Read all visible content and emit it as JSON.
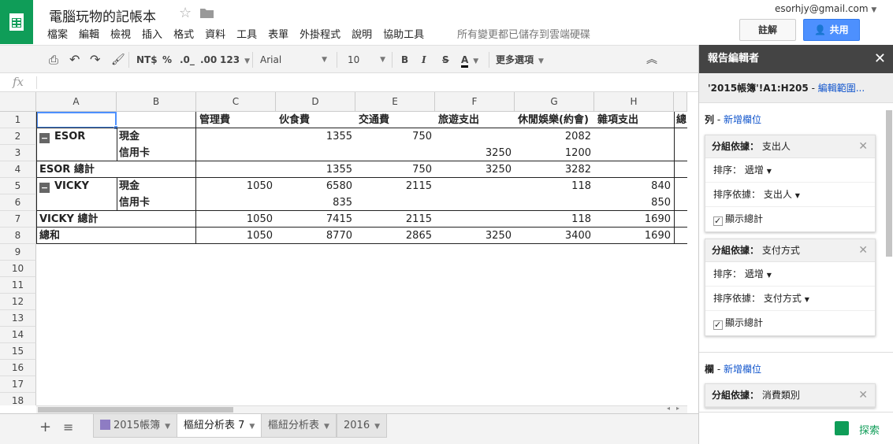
{
  "doc": {
    "title": "電腦玩物的記帳本",
    "saved_status": "所有變更都已儲存到雲端硬碟"
  },
  "menu": [
    "檔案",
    "編輯",
    "檢視",
    "插入",
    "格式",
    "資料",
    "工具",
    "表單",
    "外掛程式",
    "說明",
    "協助工具"
  ],
  "account": {
    "email": "esorhjy@gmail.com",
    "comment_label": "註解",
    "share_label": "共用"
  },
  "toolbar": {
    "currency": "NT$",
    "percent": "%",
    "dec_less": ".0_",
    "dec_more": ".00",
    "format_more": "123",
    "font": "Arial",
    "size": "10",
    "bold": "B",
    "italic": "I",
    "strike": "S",
    "text_color": "A",
    "more": "更多選項"
  },
  "formula": {
    "fx": "fx"
  },
  "grid": {
    "columns": [
      "A",
      "B",
      "C",
      "D",
      "E",
      "F",
      "G",
      "H"
    ],
    "rows": [
      "1",
      "2",
      "3",
      "4",
      "5",
      "6",
      "7",
      "8",
      "9",
      "10",
      "11",
      "12",
      "13",
      "14",
      "15",
      "16",
      "17",
      "18"
    ],
    "headers": {
      "c": "管理費",
      "d": "伙食費",
      "e": "交通費",
      "f": "旅遊支出",
      "g": "休閒娛樂(約會)",
      "h": "雜項支出",
      "i": "總"
    },
    "r2": {
      "a": "ESOR",
      "b": "現金",
      "d": "1355",
      "e": "750",
      "g": "2082"
    },
    "r3": {
      "b": "信用卡",
      "f": "3250",
      "g": "1200"
    },
    "r4": {
      "a": "ESOR 總計",
      "d": "1355",
      "e": "750",
      "f": "3250",
      "g": "3282"
    },
    "r5": {
      "a": "VICKY",
      "b": "現金",
      "c": "1050",
      "d": "6580",
      "e": "2115",
      "g": "118",
      "h": "840"
    },
    "r6": {
      "b": "信用卡",
      "d": "835",
      "h": "850"
    },
    "r7": {
      "a": "VICKY 總計",
      "c": "1050",
      "d": "7415",
      "e": "2115",
      "g": "118",
      "h": "1690"
    },
    "r8": {
      "a": "總和",
      "c": "1050",
      "d": "8770",
      "e": "2865",
      "f": "3250",
      "g": "3400",
      "h": "1690"
    }
  },
  "sheets": [
    "2015帳簿",
    "樞紐分析表 7",
    "樞紐分析表",
    "2016"
  ],
  "panel": {
    "title": "報告編輯者",
    "range": "'2015帳簿'!A1:H205",
    "range_sep": " - ",
    "edit_range": "編輯範圍...",
    "rows_label": "列",
    "cols_label": "欄",
    "add_field": "新增欄位",
    "sep": " - ",
    "group_by": "分組依據：",
    "order_label": "排序：",
    "order_value": "遞增",
    "sort_by_label": "排序依據：",
    "show_totals": "顯示總計",
    "card1_field": "支出人",
    "card2_field": "支付方式",
    "card3_field": "消費類別"
  },
  "explore": {
    "label": "探索"
  }
}
